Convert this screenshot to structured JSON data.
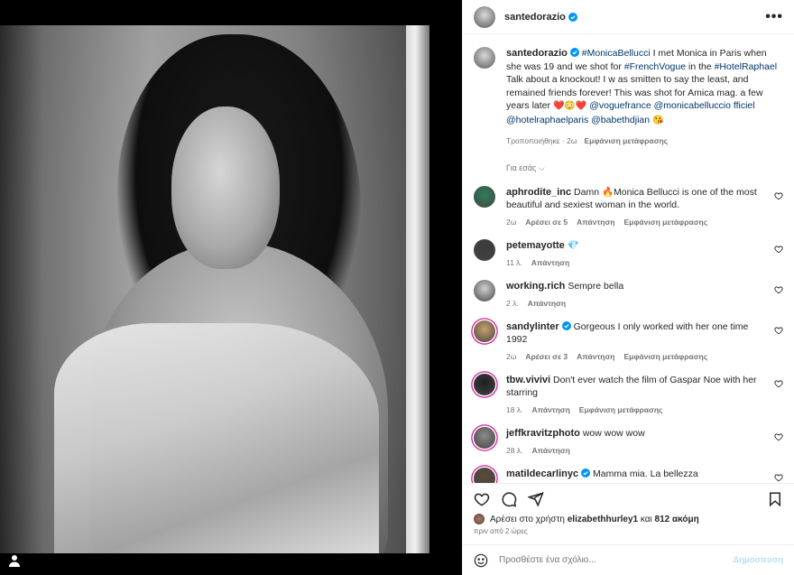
{
  "post": {
    "author": "santedorazio",
    "more_label": "•••"
  },
  "caption": {
    "username": "santedorazio",
    "text_1": " ",
    "tag_1": "#MonicaBellucci",
    "text_2": " I met Monica in Paris when she was 19 and we shot for ",
    "tag_2": "#FrenchVogue",
    "text_3": " in the ",
    "tag_3": "#HotelRaphael",
    "text_4": " Talk about a knockout! I w as smitten to say the least, and remained friends forever! This was shot for Amica mag. a few years later ",
    "emojis_1": "❤️😳❤️",
    "mention_1": "@voguefrance",
    "mention_2": "@monicabelluccio fficiel",
    "mention_2_text": "@monicabelluccio fficiel",
    "mention_3": "@hotelraphaelparis",
    "mention_4": "@babethdjian",
    "emoji_2": "😘",
    "edited": "Τροποποιήθηκε · 2ω",
    "see_translation": "Εμφάνιση μετάφρασης"
  },
  "for_you_label": "Για εσάς ⌵",
  "comments": [
    {
      "username": "aphrodite_inc",
      "verified": false,
      "text": "Damn 🔥Monica Bellucci is one of the most beautiful and sexiest woman in the world.",
      "time": "2ω",
      "likes": "Αρέσει σε 5",
      "reply": "Απάντηση",
      "translate": "Εμφάνιση μετάφρασης"
    },
    {
      "username": "petemayotte",
      "verified": false,
      "text": "💎",
      "time": "11 λ.",
      "likes": "",
      "reply": "Απάντηση",
      "translate": ""
    },
    {
      "username": "working.rich",
      "verified": false,
      "text": "Sempre bella",
      "time": "2 λ.",
      "likes": "",
      "reply": "Απάντηση",
      "translate": ""
    },
    {
      "username": "sandylinter",
      "verified": true,
      "text": "Gorgeous I only worked with her one time 1992",
      "time": "2ω",
      "likes": "Αρέσει σε 3",
      "reply": "Απάντηση",
      "translate": "Εμφάνιση μετάφρασης"
    },
    {
      "username": "tbw.vivivi",
      "verified": false,
      "text": "Don't ever watch the film of Gaspar Noe with her starring",
      "time": "18 λ.",
      "likes": "",
      "reply": "Απάντηση",
      "translate": "Εμφάνιση μετάφρασης"
    },
    {
      "username": "jeffkravitzphoto",
      "verified": false,
      "text": "wow wow wow",
      "time": "28 λ.",
      "likes": "",
      "reply": "Απάντηση",
      "translate": ""
    },
    {
      "username": "matildecarlinyc",
      "verified": true,
      "text": "Mamma mia. La bellezza",
      "time": "",
      "likes": "",
      "reply": "",
      "translate": ""
    }
  ],
  "likes_line": {
    "prefix": "Αρέσει στο χρήστη ",
    "user": "elizabethhurley1",
    "middle": " και ",
    "count": "812 ακόμη"
  },
  "posted_time": "πριν από 2 ώρες",
  "add_comment": {
    "placeholder": "Προσθέστε ένα σχόλιο...",
    "post_label": "Δημοσίευση"
  }
}
